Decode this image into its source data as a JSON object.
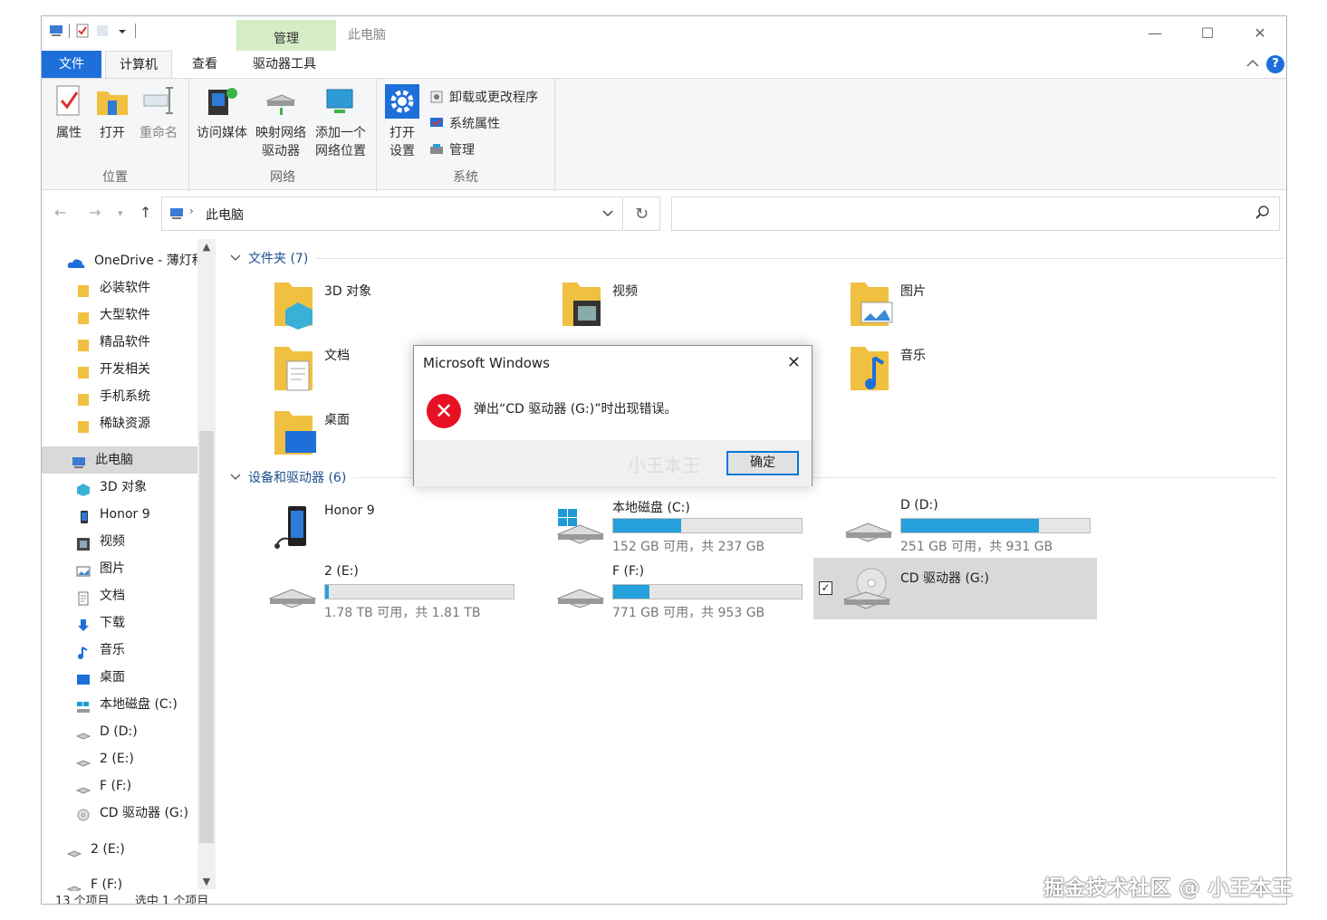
{
  "window": {
    "title": "此电脑",
    "context_tab": "管理",
    "controls": {
      "minimize": "—",
      "maximize": "☐",
      "close": "✕"
    }
  },
  "tabs": [
    {
      "label": "文件"
    },
    {
      "label": "计算机"
    },
    {
      "label": "查看"
    },
    {
      "label": "驱动器工具"
    }
  ],
  "ribbon": {
    "location": {
      "label": "位置",
      "properties": "属性",
      "open": "打开",
      "rename": "重命名"
    },
    "network": {
      "label": "网络",
      "media_1": "访问媒体",
      "map_1": "映射网络",
      "map_2": "驱动器",
      "add_1": "添加一个",
      "add_2": "网络位置"
    },
    "system": {
      "label": "系统",
      "settings_1": "打开",
      "settings_2": "设置",
      "uninstall": "卸载或更改程序",
      "sysprops": "系统属性",
      "manage": "管理"
    }
  },
  "address": {
    "crumb": "此电脑"
  },
  "sidebar": {
    "items": [
      {
        "label": "OneDrive - 薄灯科"
      },
      {
        "label": "必装软件"
      },
      {
        "label": "大型软件"
      },
      {
        "label": "精品软件"
      },
      {
        "label": "开发相关"
      },
      {
        "label": "手机系统"
      },
      {
        "label": "稀缺资源"
      },
      {
        "label": "此电脑"
      },
      {
        "label": "3D 对象"
      },
      {
        "label": "Honor 9"
      },
      {
        "label": "视频"
      },
      {
        "label": "图片"
      },
      {
        "label": "文档"
      },
      {
        "label": "下载"
      },
      {
        "label": "音乐"
      },
      {
        "label": "桌面"
      },
      {
        "label": "本地磁盘 (C:)"
      },
      {
        "label": "D (D:)"
      },
      {
        "label": "2 (E:)"
      },
      {
        "label": "F (F:)"
      },
      {
        "label": "CD 驱动器 (G:)"
      },
      {
        "label": "2 (E:)"
      },
      {
        "label": "F (F:)"
      }
    ]
  },
  "content": {
    "folders_header": "文件夹 (7)",
    "folders": [
      {
        "name": "3D 对象"
      },
      {
        "name": "视频"
      },
      {
        "name": "图片"
      },
      {
        "name": "文档"
      },
      {
        "name": "音乐"
      },
      {
        "name": "桌面"
      }
    ],
    "devices_header": "设备和驱动器 (6)",
    "devices": [
      {
        "name": "Honor 9"
      },
      {
        "name": "本地磁盘 (C:)",
        "free": "152 GB 可用，共 237 GB",
        "used_fraction": 0.36
      },
      {
        "name": "D (D:)",
        "free": "251 GB 可用，共 931 GB",
        "used_fraction": 0.73
      },
      {
        "name": "2 (E:)",
        "free": "1.78 TB 可用，共 1.81 TB",
        "used_fraction": 0.02
      },
      {
        "name": "F (F:)",
        "free": "771 GB 可用，共 953 GB",
        "used_fraction": 0.19
      },
      {
        "name": "CD 驱动器 (G:)",
        "checked": "✓"
      }
    ]
  },
  "status": {
    "count": "13 个项目",
    "selected": "选中 1 个项目"
  },
  "dialog": {
    "title": "Microsoft Windows",
    "message": "弹出“CD 驱动器 (G:)”时出现错误。",
    "ok": "确定",
    "watermark": "小王本王"
  },
  "watermark": "掘金技术社区 @ 小王本王",
  "colors": {
    "accent": "#1e6fd9",
    "drive_bar": "#26a0da",
    "error": "#e81123",
    "context_tab": "#d4edc4"
  }
}
